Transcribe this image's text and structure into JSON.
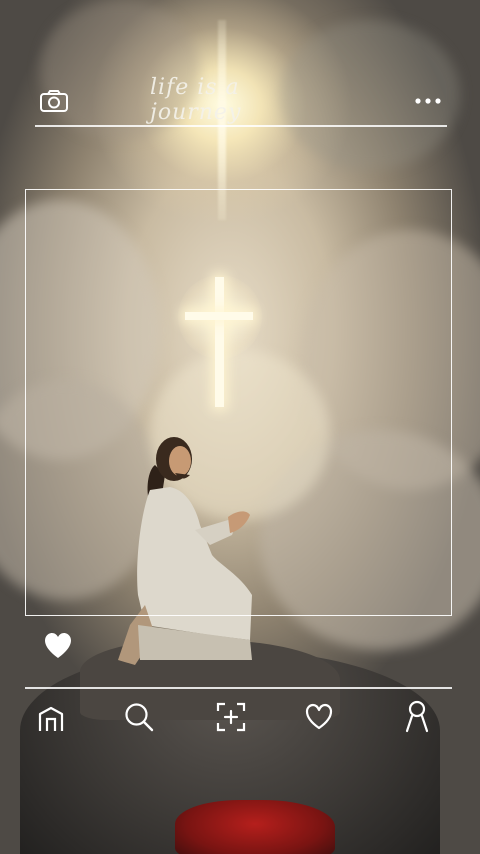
{
  "header": {
    "title": "life is a journey",
    "camera_icon": "camera-icon",
    "more_icon": "more-dots-icon"
  },
  "photo_frame": {
    "like_icon": "heart-icon"
  },
  "bottom_nav": {
    "items": [
      {
        "icon": "home-icon"
      },
      {
        "icon": "search-icon"
      },
      {
        "icon": "add-post-icon"
      },
      {
        "icon": "heart-outline-icon"
      },
      {
        "icon": "profile-icon"
      }
    ]
  },
  "colors": {
    "line": "#ffffff",
    "sky_dark": "#2a3c4c",
    "glow": "#fff6d8"
  }
}
